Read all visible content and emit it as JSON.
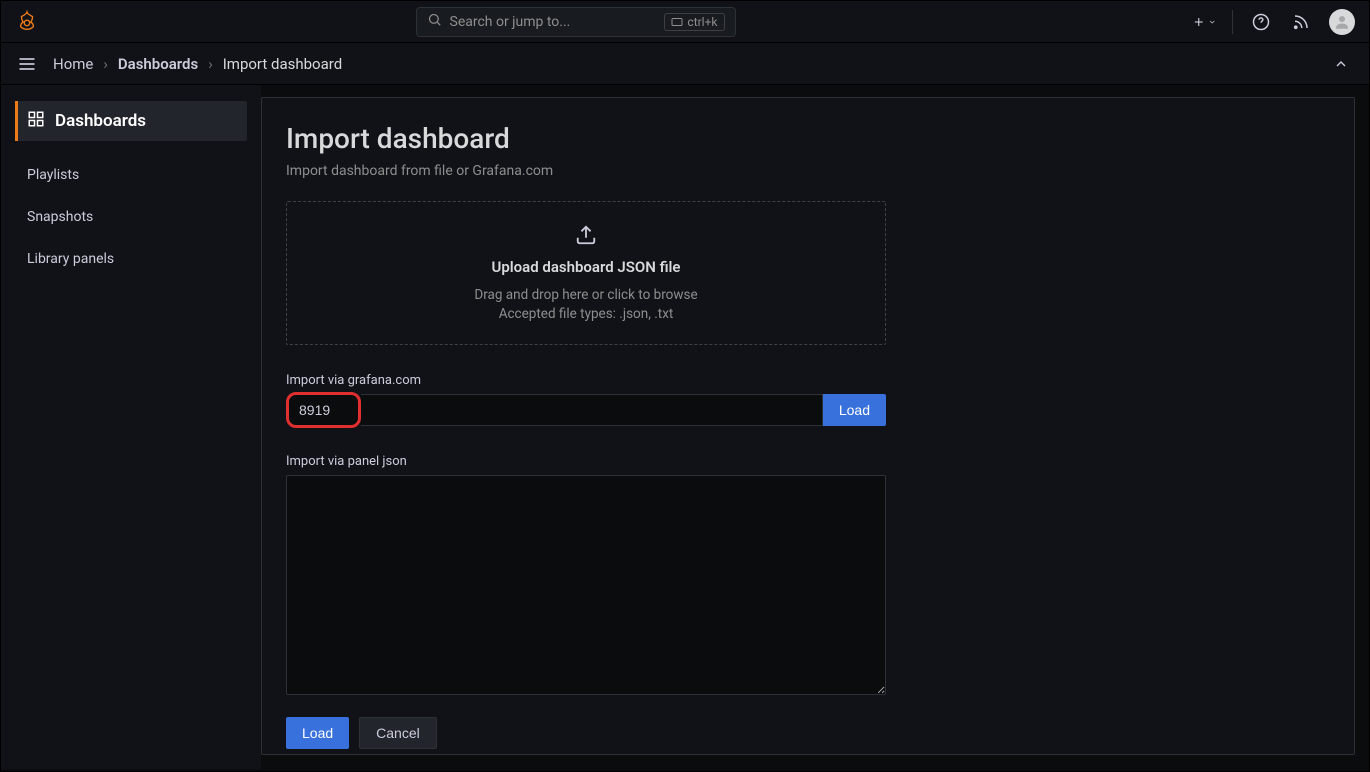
{
  "header": {
    "search_placeholder": "Search or jump to...",
    "search_shortcut": "ctrl+k"
  },
  "breadcrumb": {
    "items": [
      "Home",
      "Dashboards",
      "Import dashboard"
    ]
  },
  "sidebar": {
    "active_label": "Dashboards",
    "items": [
      {
        "label": "Playlists"
      },
      {
        "label": "Snapshots"
      },
      {
        "label": "Library panels"
      }
    ]
  },
  "page": {
    "title": "Import dashboard",
    "subtitle": "Import dashboard from file or Grafana.com"
  },
  "dropzone": {
    "title": "Upload dashboard JSON file",
    "hint1": "Drag and drop here or click to browse",
    "hint2": "Accepted file types: .json, .txt"
  },
  "import_url": {
    "label": "Import via grafana.com",
    "value": "8919",
    "load_label": "Load"
  },
  "import_json": {
    "label": "Import via panel json",
    "value": ""
  },
  "actions": {
    "load": "Load",
    "cancel": "Cancel"
  }
}
